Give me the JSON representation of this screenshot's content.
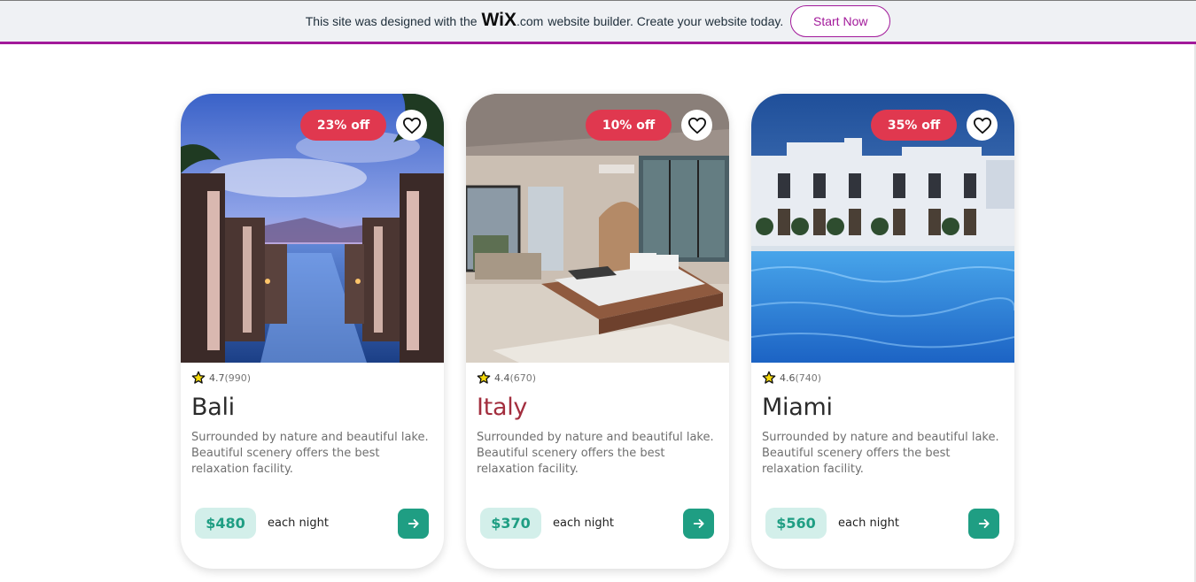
{
  "banner": {
    "prefix": "This site was designed with the",
    "logo": "WiX",
    "logo_suffix": ".com",
    "suffix": "website builder. Create your website today.",
    "cta_label": "Start Now",
    "accent_color": "#a2199a"
  },
  "cards": [
    {
      "discount": "23% off",
      "rating": "4.7",
      "reviews": "(990)",
      "title": "Bali",
      "description": "Surrounded by nature and beautiful lake. Beautiful scenery offers the best relaxation facility.",
      "price": "$480",
      "per": "each night"
    },
    {
      "discount": "10% off",
      "rating": "4.4",
      "reviews": "(670)",
      "title": "Italy",
      "description": "Surrounded by nature and beautiful lake. Beautiful scenery offers the best relaxation facility.",
      "price": "$370",
      "per": "each night"
    },
    {
      "discount": "35% off",
      "rating": "4.6",
      "reviews": "(740)",
      "title": "Miami",
      "description": "Surrounded by nature and beautiful lake. Beautiful scenery offers the best relaxation facility.",
      "price": "$560",
      "per": "each night"
    }
  ],
  "colors": {
    "discount": "#e0384f",
    "price_bg": "#d3efea",
    "price_text": "#1f9e83",
    "button": "#1f9e83",
    "italy_title": "#a32e3e"
  },
  "icons": [
    "heart-icon",
    "star-icon",
    "arrow-right-icon"
  ]
}
